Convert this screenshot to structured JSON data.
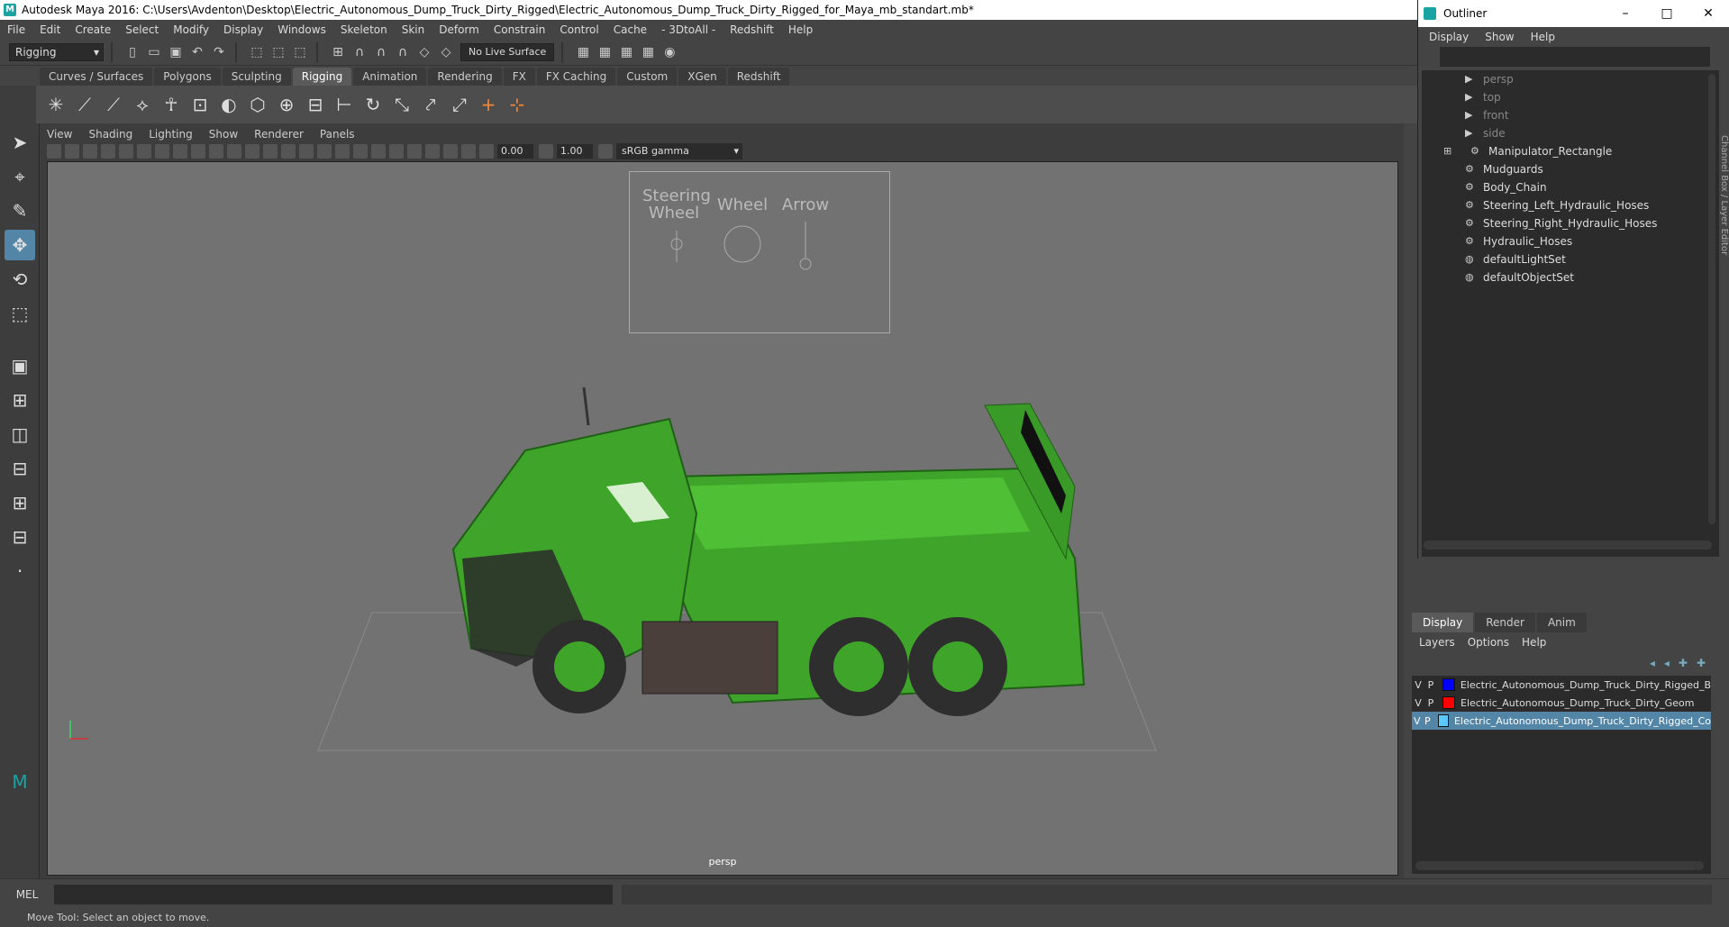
{
  "window": {
    "title": "Autodesk Maya 2016: C:\\Users\\Avdenton\\Desktop\\Electric_Autonomous_Dump_Truck_Dirty_Rigged\\Electric_Autonomous_Dump_Truck_Dirty_Rigged_for_Maya_mb_standart.mb*"
  },
  "menubar": [
    "File",
    "Edit",
    "Create",
    "Select",
    "Modify",
    "Display",
    "Windows",
    "Skeleton",
    "Skin",
    "Deform",
    "Constrain",
    "Control",
    "Cache",
    "- 3DtoAll -",
    "Redshift",
    "Help"
  ],
  "statusline": {
    "mode": "Rigging",
    "live_surface": "No Live Surface"
  },
  "shelf": {
    "tabs": [
      "Curves / Surfaces",
      "Polygons",
      "Sculpting",
      "Rigging",
      "Animation",
      "Rendering",
      "FX",
      "FX Caching",
      "Custom",
      "XGen",
      "Redshift"
    ],
    "active": "Rigging"
  },
  "viewport": {
    "menu": [
      "View",
      "Shading",
      "Lighting",
      "Show",
      "Renderer",
      "Panels"
    ],
    "exposure": "0.00",
    "gamma_value": "1.00",
    "color_space": "sRGB gamma",
    "camera_label": "persp",
    "hud": {
      "steering": "Steering\nWheel",
      "wheel": "Wheel",
      "arrow": "Arrow"
    }
  },
  "outliner": {
    "title": "Outliner",
    "menu": [
      "Display",
      "Show",
      "Help"
    ],
    "items": [
      {
        "label": "persp",
        "type": "camera"
      },
      {
        "label": "top",
        "type": "camera"
      },
      {
        "label": "front",
        "type": "camera"
      },
      {
        "label": "side",
        "type": "camera"
      },
      {
        "label": "Manipulator_Rectangle",
        "type": "group"
      },
      {
        "label": "Mudguards",
        "type": "group"
      },
      {
        "label": "Body_Chain",
        "type": "group"
      },
      {
        "label": "Steering_Left_Hydraulic_Hoses",
        "type": "group"
      },
      {
        "label": "Steering_Right_Hydraulic_Hoses",
        "type": "group"
      },
      {
        "label": "Hydraulic_Hoses",
        "type": "group"
      },
      {
        "label": "defaultLightSet",
        "type": "set"
      },
      {
        "label": "defaultObjectSet",
        "type": "set"
      }
    ]
  },
  "side_tabs": "Channel Box / Layer Editor",
  "layer_editor": {
    "tabs": [
      "Display",
      "Render",
      "Anim"
    ],
    "active_tab": "Display",
    "menu": [
      "Layers",
      "Options",
      "Help"
    ],
    "layers": [
      {
        "v": "V",
        "p": "P",
        "color": "#0000ff",
        "name": "Electric_Autonomous_Dump_Truck_Dirty_Rigged_B"
      },
      {
        "v": "V",
        "p": "P",
        "color": "#ff0000",
        "name": "Electric_Autonomous_Dump_Truck_Dirty_Geom"
      },
      {
        "v": "V",
        "p": "P",
        "color": "#5bc8ff",
        "name": "Electric_Autonomous_Dump_Truck_Dirty_Rigged_Co"
      }
    ]
  },
  "command_line": {
    "language": "MEL"
  },
  "help_line": "Move Tool: Select an object to move.",
  "colors": {
    "truck": "#3ea52a",
    "selection": "#5285a6",
    "viewport_bg": "#727272"
  }
}
